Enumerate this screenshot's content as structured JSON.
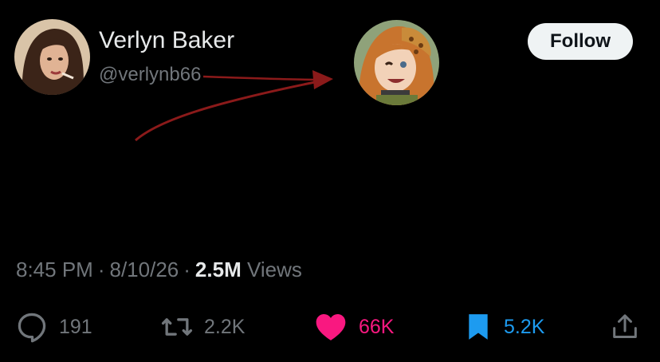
{
  "author": {
    "display_name": "Verlyn Baker",
    "handle": "@verlynb66",
    "avatar_icon": "profile-photo"
  },
  "follow_button": {
    "label": "Follow"
  },
  "reply_target": {
    "avatar_icon": "cartoon-avatar"
  },
  "tweet": {
    "text": ""
  },
  "meta": {
    "time": "8:45 PM",
    "separator": "·",
    "date": "8/10/26",
    "views_count": "2.5M",
    "views_label": "Views"
  },
  "actions": {
    "reply": {
      "icon": "reply-icon",
      "count": "191"
    },
    "retweet": {
      "icon": "retweet-icon",
      "count": "2.2K"
    },
    "like": {
      "icon": "heart-icon",
      "count": "66K",
      "active": true,
      "color": "#f91880"
    },
    "bookmark": {
      "icon": "bookmark-icon",
      "count": "5.2K",
      "active": true,
      "color": "#1d9bf0"
    },
    "share": {
      "icon": "share-icon"
    }
  },
  "colors": {
    "background": "#000000",
    "primary_text": "#e7e9ea",
    "secondary_text": "#71767b",
    "arrow": "#8b1a1a"
  }
}
